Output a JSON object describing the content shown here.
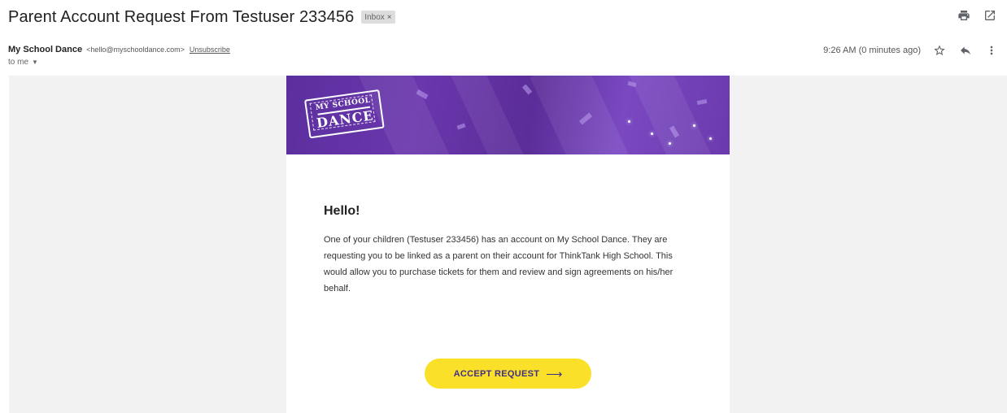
{
  "email": {
    "subject": "Parent Account Request From Testuser 233456",
    "label": "Inbox",
    "label_remove": "×",
    "sender_name": "My School Dance",
    "sender_email": "<hello@myschooldance.com>",
    "unsubscribe": "Unsubscribe",
    "to_line": "to me",
    "time": "9:26 AM (0 minutes ago)"
  },
  "icons": {
    "print": "print-icon",
    "open_new_window": "open-in-new-window-icon",
    "star": "star-icon",
    "reply": "reply-icon",
    "more": "more-vert-icon",
    "expand_recipients": "chevron-down-icon"
  },
  "banner": {
    "logo_line1": "MY SCHOOL",
    "logo_line2": "DANCE"
  },
  "content": {
    "greeting": "Hello!",
    "body": "One of your children (Testuser 233456) has an account on My School Dance. They are requesting you to be linked as a parent on their account for ThinkTank High School. This would allow you to purchase tickets for them and review and sign agreements on his/her behalf.",
    "button_label": "ACCEPT REQUEST",
    "button_arrow": "⟶"
  },
  "colors": {
    "banner_purple": "#5b2f9e",
    "button_yellow": "#fbe029",
    "button_text": "#3f2f87",
    "email_bg": "#f2f2f2"
  }
}
